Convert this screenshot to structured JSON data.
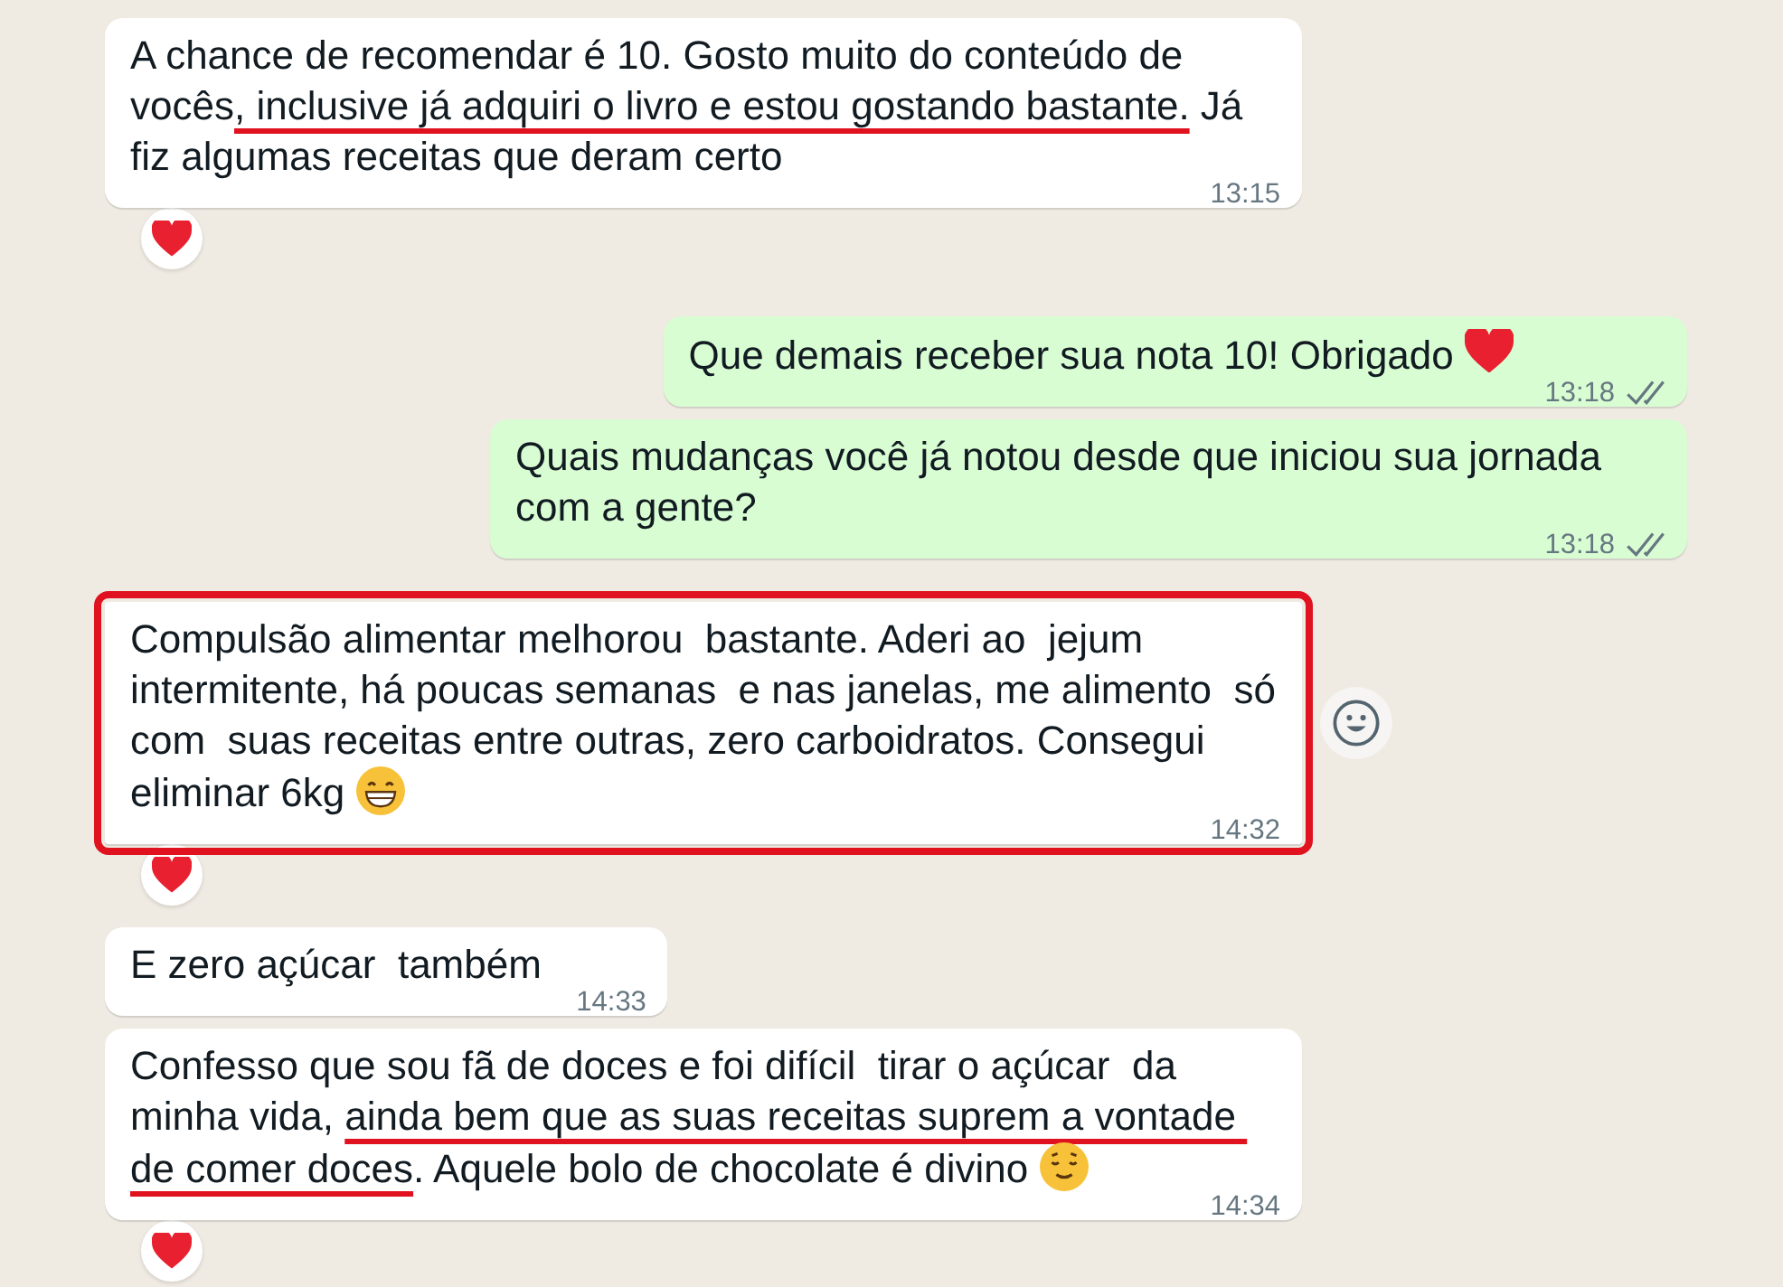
{
  "messages": [
    {
      "kind": "incoming",
      "segments": [
        {
          "text": "A chance de recomendar é 10. Gosto muito do conteúdo de vocês"
        },
        {
          "text": ", inclusive já adquiri o livro e estou gostando bastante.",
          "underlined": true
        },
        {
          "text": " Já fiz algumas receitas que deram certo"
        }
      ],
      "time": "13:15",
      "reaction": {
        "kind": "heart"
      }
    },
    {
      "kind": "outgoing",
      "segments": [
        {
          "text": "Que demais receber sua nota 10! Obrigado "
        }
      ],
      "emoji": {
        "kind": "heart"
      },
      "time": "13:18",
      "delivery": {
        "kind": "delivered"
      }
    },
    {
      "kind": "outgoing",
      "segments": [
        {
          "text": "Quais mudanças você já notou desde que iniciou sua jornada com a gente?"
        }
      ],
      "time": "13:18",
      "delivery": {
        "kind": "delivered"
      }
    },
    {
      "kind": "incoming",
      "segments": [
        {
          "text": "Compulsão alimentar melhorou  bastante. Aderi ao  jejum intermitente, há poucas semanas  e nas janelas, me alimento  só com  suas receitas entre outras, zero carboidratos. Consegui eliminar 6kg "
        }
      ],
      "emoji": {
        "kind": "grin"
      },
      "time": "14:32",
      "reaction": {
        "kind": "heart"
      },
      "highlighted": true,
      "react_button": true
    },
    {
      "kind": "incoming",
      "segments": [
        {
          "text": "E zero açúcar  também"
        }
      ],
      "time": "14:33"
    },
    {
      "kind": "incoming",
      "segments": [
        {
          "text": "Confesso que sou fã de doces e foi difícil  tirar o açúcar  da minha vida, "
        },
        {
          "text": "ainda bem que as suas receitas suprem a vontade de comer doces",
          "underlined": true
        },
        {
          "text": ". Aquele bolo de chocolate é divino "
        }
      ],
      "emoji": {
        "kind": "relieved"
      },
      "time": "14:34",
      "reaction": {
        "kind": "heart"
      }
    }
  ]
}
